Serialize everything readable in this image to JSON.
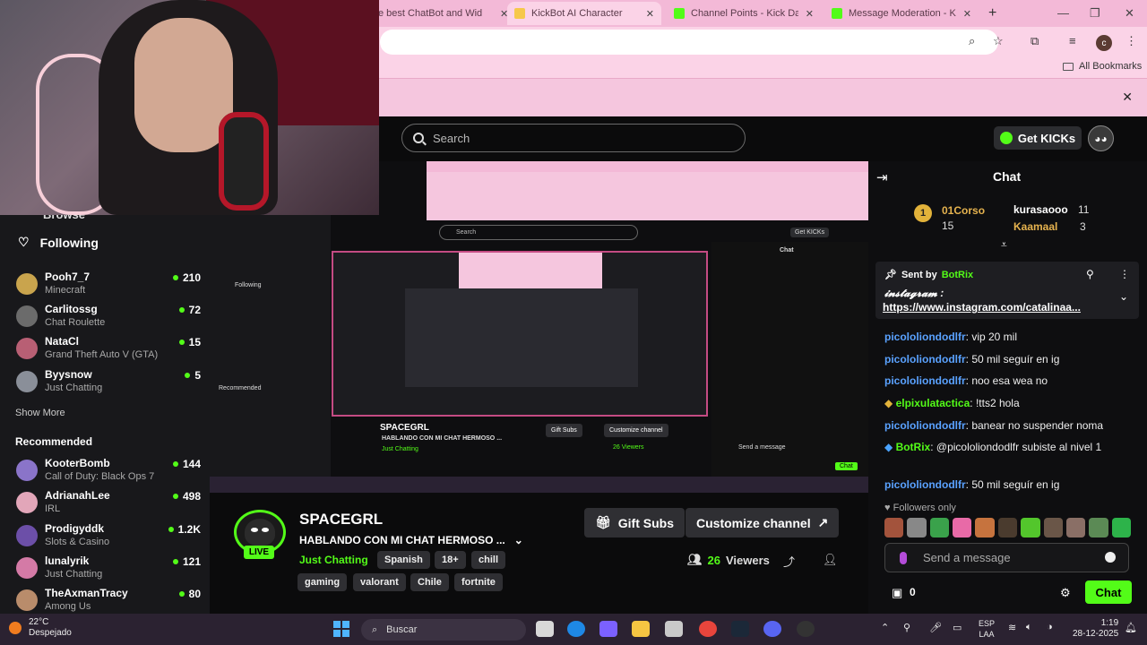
{
  "browser": {
    "tabs": [
      {
        "label": "e best ChatBot and Wid",
        "favicon_color": "#f6c84a"
      },
      {
        "label": "KickBot AI Character",
        "favicon_color": "#f6c84a",
        "active": true
      },
      {
        "label": "Channel Points - Kick Dash",
        "favicon_color": "#53fc18"
      },
      {
        "label": "Message Moderation - Kic",
        "favicon_color": "#53fc18"
      }
    ],
    "new_tab": "+",
    "profile_initial": "c",
    "bookmarks_label": "All Bookmarks"
  },
  "header": {
    "search_placeholder": "Search",
    "get_kicks": "Get KICKs"
  },
  "sidebar": {
    "browse": "Browse",
    "following": "Following",
    "following_items": [
      {
        "name": "Pooh7_7",
        "game": "Minecraft",
        "viewers": "210",
        "color": "#c9a44d"
      },
      {
        "name": "Carlitossg",
        "game": "Chat Roulette",
        "viewers": "72",
        "color": "#6b6b6b"
      },
      {
        "name": "NataCl",
        "game": "Grand Theft Auto V (GTA)",
        "viewers": "15",
        "color": "#b85f74"
      },
      {
        "name": "Byysnow",
        "game": "Just Chatting",
        "viewers": "5",
        "color": "#8a8f99"
      }
    ],
    "show_more": "Show More",
    "recommended": "Recommended",
    "recommended_items": [
      {
        "name": "KooterBomb",
        "game": "Call of Duty: Black Ops 7",
        "viewers": "144",
        "color": "#8a74c9"
      },
      {
        "name": "AdrianahLee",
        "game": "IRL",
        "viewers": "498",
        "color": "#e2a6b9"
      },
      {
        "name": "Prodigyddk",
        "game": "Slots & Casino",
        "viewers": "1.2K",
        "color": "#6c4fa8"
      },
      {
        "name": "lunalyrik",
        "game": "Just Chatting",
        "viewers": "121",
        "color": "#d47aa6"
      },
      {
        "name": "TheAxmanTracy",
        "game": "Among Us",
        "viewers": "80",
        "color": "#b98c6b"
      }
    ]
  },
  "nested": {
    "search": "Search",
    "get_kicks": "Get KICKs",
    "chat": "Chat",
    "channel": "SPACEGRL",
    "title": "HABLANDO CON MI CHAT HERMOSO ...",
    "category": "Just Chatting",
    "viewers": "26 Viewers",
    "gift": "Gift Subs",
    "customize": "Customize channel",
    "send": "Send a message",
    "chat_btn": "Chat",
    "following": "Following",
    "recommended": "Recommended"
  },
  "channel": {
    "name": "SPACEGRL",
    "title": "HABLANDO CON MI CHAT HERMOSO ...",
    "live": "LIVE",
    "category": "Just Chatting",
    "tags": [
      "Spanish",
      "18+",
      "chill",
      "gaming",
      "valorant",
      "Chile",
      "fortnite"
    ],
    "gift_subs": "Gift Subs",
    "customize": "Customize channel",
    "viewers_count": "26",
    "viewers_label": "Viewers"
  },
  "chat": {
    "title": "Chat",
    "leaderboard": {
      "rank": "1",
      "first_name": "01Corso",
      "first_count": "15",
      "second_name": "kurasaooo",
      "second_count": "11",
      "third_name": "Kaamaal",
      "third_count": "3"
    },
    "pinned": {
      "sent_by": "Sent by",
      "bot": "BotRix",
      "text": "𝓲𝓷𝓼𝓽𝓪𝓰𝓻𝓪𝓶 :",
      "link": "https://www.instagram.com/catalinaa..."
    },
    "messages": [
      {
        "user": "picololiondodlfr",
        "text": ": vip 20 mil"
      },
      {
        "user": "picololiondodlfr",
        "text": ": 50 mil seguír en ig"
      },
      {
        "user": "picololiondodlfr",
        "text": ": noo esa wea no"
      },
      {
        "user": "elpixulatactica",
        "text": ": !tts2 hola"
      },
      {
        "user": "picololiondodlfr",
        "text": ": banear no suspender noma"
      },
      {
        "user": "BotRix",
        "text": ": @picololiondodlfr subiste al nivel 1"
      },
      {
        "user": "picololiondodlfr",
        "text": ": 50 mil seguír en ig"
      }
    ],
    "followers_only": "Followers only",
    "send_placeholder": "Send a message",
    "gift_count": "0",
    "chat_button": "Chat"
  },
  "taskbar": {
    "temp": "22°C",
    "weather": "Despejado",
    "search": "Buscar",
    "lang1": "ESP",
    "lang2": "LAA",
    "time": "1:19",
    "date": "28-12-2025"
  }
}
